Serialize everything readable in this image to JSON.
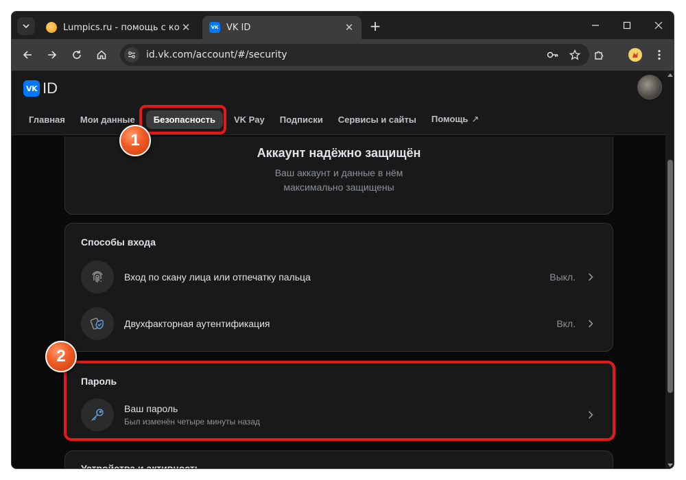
{
  "browser": {
    "tabs": [
      {
        "title": "Lumpics.ru - помощь с компьютером",
        "favicon": "orange-circle-favicon"
      },
      {
        "title": "VK ID",
        "favicon": "vk-favicon"
      }
    ],
    "url": "id.vk.com/account/#/security"
  },
  "vk": {
    "logo_text": "ID",
    "logo_mark": "VK",
    "nav": [
      {
        "label": "Главная"
      },
      {
        "label": "Мои данные"
      },
      {
        "label": "Безопасность",
        "active": true
      },
      {
        "label": "VK Pay"
      },
      {
        "label": "Подписки"
      },
      {
        "label": "Сервисы и сайты"
      },
      {
        "label": "Помощь",
        "external": true
      }
    ],
    "status_card": {
      "title": "Аккаунт надёжно защищён",
      "subtitle_line1": "Ваш аккаунт и данные в нём",
      "subtitle_line2": "максимально защищены"
    },
    "login_methods": {
      "title": "Способы входа",
      "items": [
        {
          "label": "Вход по скану лица или отпечатку пальца",
          "value": "Выкл.",
          "icon": "fingerprint-icon"
        },
        {
          "label": "Двухфакторная аутентификация",
          "value": "Вкл.",
          "icon": "shield-check-icon"
        }
      ]
    },
    "password": {
      "title": "Пароль",
      "item_label": "Ваш пароль",
      "item_sub": "Был изменён четыре минуты назад",
      "icon": "key-icon"
    },
    "devices": {
      "title": "Устройства и активность"
    }
  },
  "annotations": {
    "step1": "1",
    "step2": "2"
  },
  "colors": {
    "accent": "#0077ff",
    "highlight": "#e21a1a",
    "badge": "#ef5a24"
  }
}
